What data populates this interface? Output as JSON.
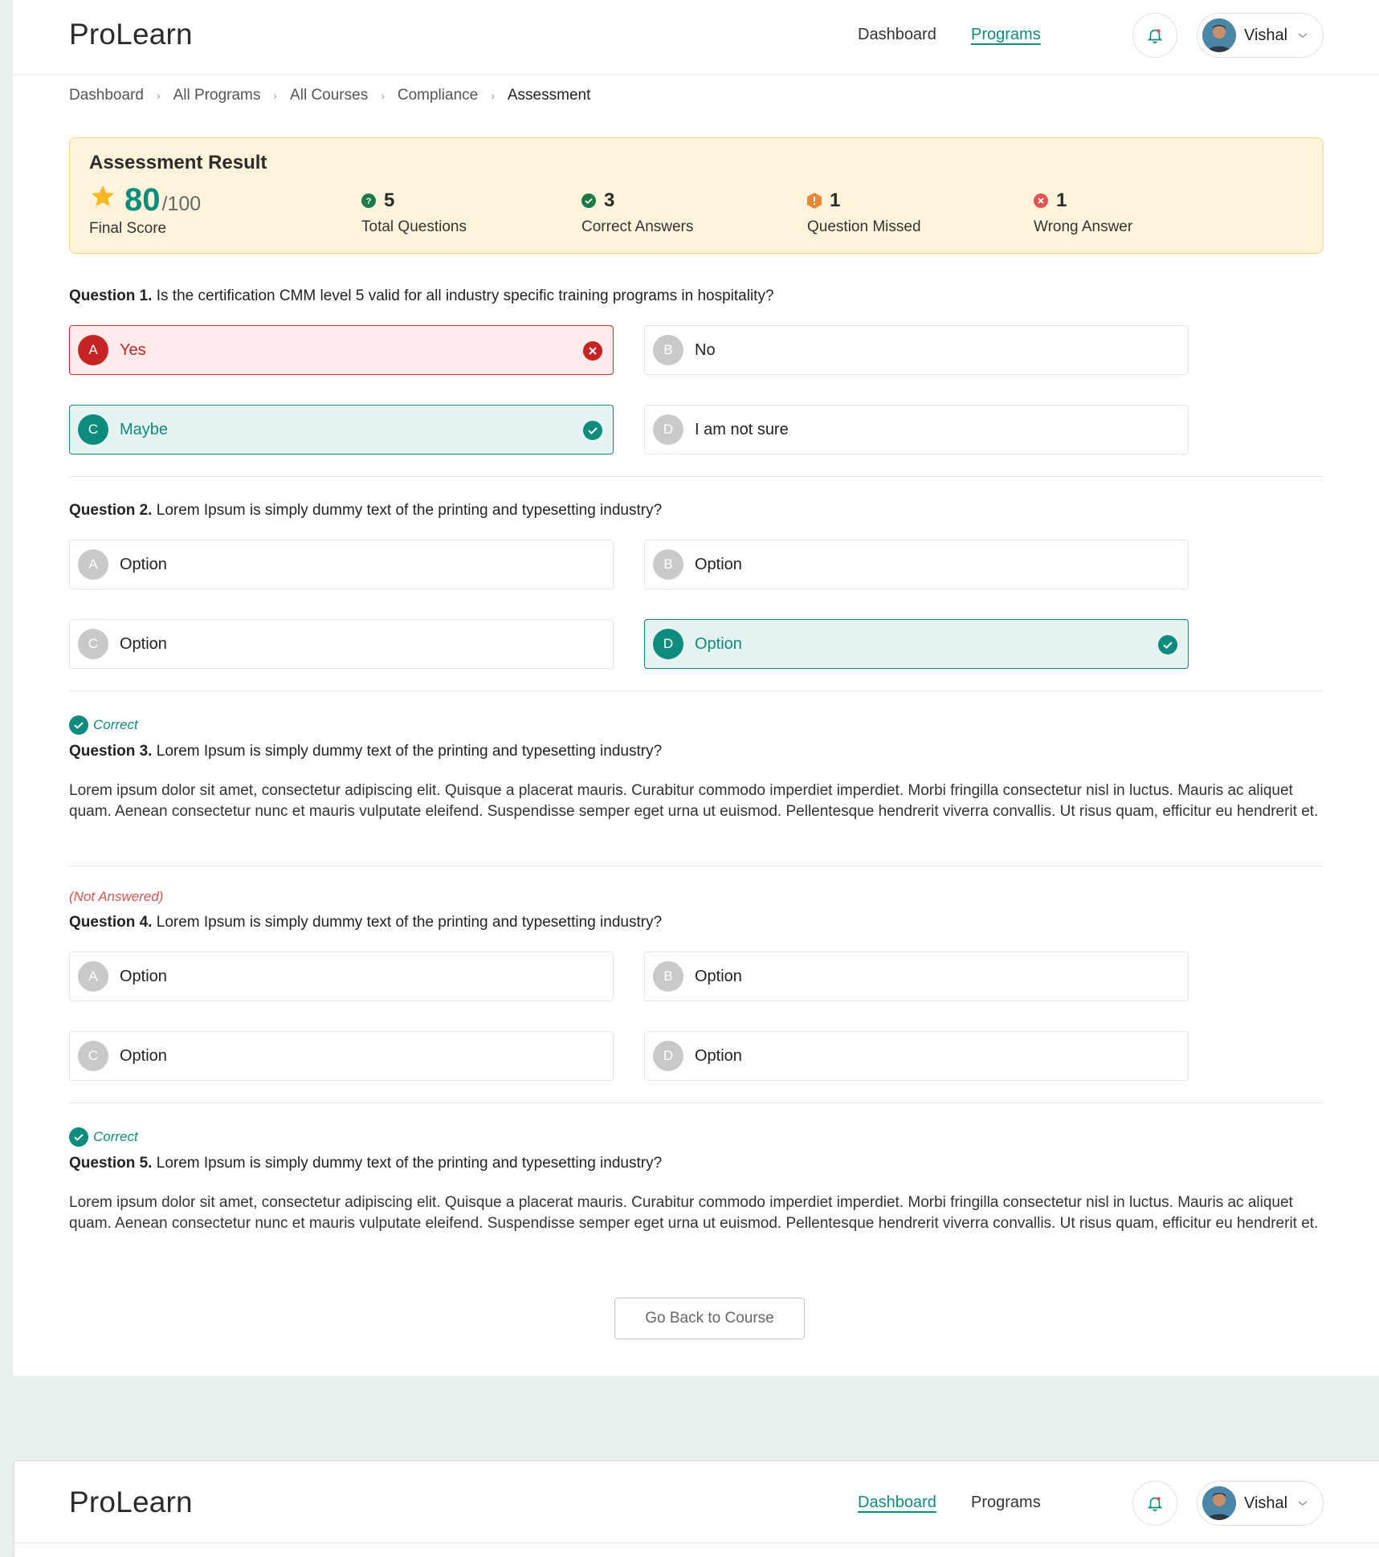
{
  "app": {
    "logo": "ProLearn"
  },
  "nav": {
    "dashboard": "Dashboard",
    "programs": "Programs"
  },
  "user": {
    "name": "Vishal"
  },
  "breadcrumb": [
    "Dashboard",
    "All Programs",
    "All Courses",
    "Compliance",
    "Assessment"
  ],
  "result": {
    "title": "Assessment Result",
    "score": "80",
    "score_max": "/100",
    "score_label": "Final Score",
    "total_questions": {
      "value": "5",
      "label": "Total Questions"
    },
    "correct_answers": {
      "value": "3",
      "label": "Correct Answers"
    },
    "question_missed": {
      "value": "1",
      "label": "Question Missed"
    },
    "wrong_answer": {
      "value": "1",
      "label": "Wrong Answer"
    }
  },
  "questions": [
    {
      "prefix": "Question 1.",
      "text": " Is the certification CMM level 5 valid for all industry specific training programs in hospitality?",
      "options": [
        {
          "letter": "A",
          "text": "Yes",
          "state": "wrong"
        },
        {
          "letter": "B",
          "text": "No",
          "state": "none"
        },
        {
          "letter": "C",
          "text": "Maybe",
          "state": "right"
        },
        {
          "letter": "D",
          "text": "I am not sure",
          "state": "none"
        }
      ]
    },
    {
      "prefix": "Question 2.",
      "text": " Lorem Ipsum is simply dummy text of the printing and typesetting industry?",
      "options": [
        {
          "letter": "A",
          "text": "Option",
          "state": "none"
        },
        {
          "letter": "B",
          "text": "Option",
          "state": "none"
        },
        {
          "letter": "C",
          "text": "Option",
          "state": "none"
        },
        {
          "letter": "D",
          "text": "Option",
          "state": "right"
        }
      ]
    },
    {
      "status": "Correct",
      "prefix": "Question 3.",
      "text": " Lorem Ipsum is simply dummy text of the printing and typesetting industry?",
      "answer": "Lorem ipsum dolor sit amet, consectetur adipiscing elit. Quisque a placerat mauris. Curabitur commodo imperdiet imperdiet. Morbi fringilla consectetur nisl in luctus. Mauris ac aliquet quam. Aenean consectetur nunc et mauris vulputate eleifend. Suspendisse semper eget urna ut euismod. Pellentesque hendrerit viverra convallis. Ut risus quam, efficitur eu hendrerit et."
    },
    {
      "status": "(Not Answered)",
      "prefix": "Question 4.",
      "text": " Lorem Ipsum is simply dummy text of the printing and typesetting industry?",
      "options": [
        {
          "letter": "A",
          "text": "Option",
          "state": "none"
        },
        {
          "letter": "B",
          "text": "Option",
          "state": "none"
        },
        {
          "letter": "C",
          "text": "Option",
          "state": "none"
        },
        {
          "letter": "D",
          "text": "Option",
          "state": "none"
        }
      ]
    },
    {
      "status": "Correct",
      "prefix": "Question 5.",
      "text": " Lorem Ipsum is simply dummy text of the printing and typesetting industry?",
      "answer": "Lorem ipsum dolor sit amet, consectetur adipiscing elit. Quisque a placerat mauris. Curabitur commodo imperdiet imperdiet. Morbi fringilla consectetur nisl in luctus. Mauris ac aliquet quam. Aenean consectetur nunc et mauris vulputate eleifend. Suspendisse semper eget urna ut euismod. Pellentesque hendrerit viverra convallis. Ut risus quam, efficitur eu hendrerit et."
    }
  ],
  "actions": {
    "back": "Go Back to Course"
  },
  "colors": {
    "brand": "#0d8b7d",
    "wrong": "#c52424",
    "missed": "#e8893a",
    "card_bg": "#fff4db",
    "page_bg": "#e7f2f1"
  }
}
